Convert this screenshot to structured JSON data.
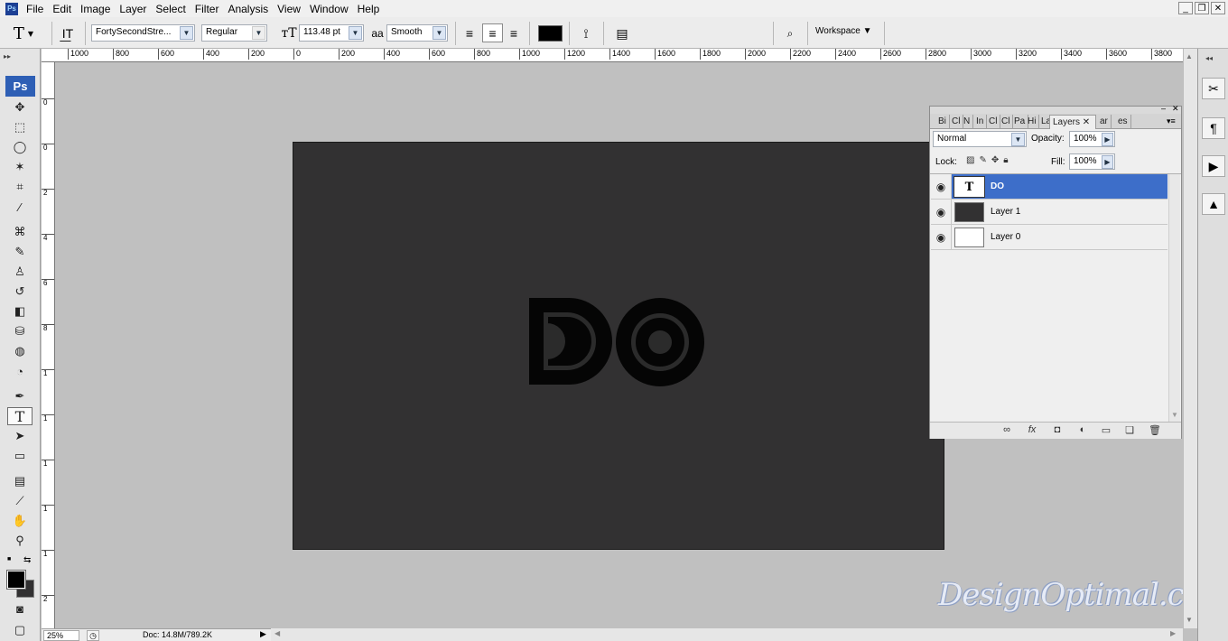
{
  "menu": [
    "File",
    "Edit",
    "Image",
    "Layer",
    "Select",
    "Filter",
    "Analysis",
    "View",
    "Window",
    "Help"
  ],
  "window_controls": {
    "minimize": "_",
    "restore": "❐",
    "close": "✕"
  },
  "options": {
    "font_family": "FortySecondStre...",
    "font_style": "Regular",
    "font_size": "113.48 pt",
    "aa_label": "aa",
    "antialias": "Smooth",
    "text_color": "#000000",
    "workspace_label": "Workspace"
  },
  "toolbox": {
    "badge": "Ps"
  },
  "ruler": {
    "h_labels": [
      "1000",
      "800",
      "600",
      "400",
      "200",
      "0",
      "200",
      "400",
      "600",
      "800",
      "1000",
      "1200",
      "1400",
      "1600",
      "1800",
      "2000",
      "2200",
      "2400",
      "2600",
      "2800",
      "3000",
      "3200",
      "3400",
      "3600",
      "3800"
    ],
    "v_labels": [
      "0",
      "0",
      "2",
      "4",
      "6",
      "8",
      "1",
      "1",
      "1",
      "1",
      "1",
      "2",
      "2"
    ]
  },
  "canvas": {
    "doc_color": "#323132",
    "artwork_text": "DO"
  },
  "watermark": "DesignOptimal.com",
  "status": {
    "zoom": "25%",
    "doc": "Doc: 14.8M/789.2K"
  },
  "layers_panel": {
    "tabs": [
      "Bi",
      "Cl",
      "N",
      "In",
      "Cl",
      "Cl",
      "Pa",
      "Hi",
      "La",
      "Layers",
      "ar",
      "es"
    ],
    "blend_mode": "Normal",
    "opacity_label": "Opacity:",
    "opacity": "100%",
    "lock_label": "Lock:",
    "fill_label": "Fill:",
    "fill": "100%",
    "layers": [
      {
        "name": "DO",
        "thumb": "T",
        "selected": true
      },
      {
        "name": "Layer 1",
        "thumb": "",
        "selected": false
      },
      {
        "name": "Layer 0",
        "thumb": "",
        "selected": false
      }
    ]
  },
  "colors": {
    "accent": "#3d6ec9",
    "foreground": "#000000",
    "background": "#323132"
  }
}
